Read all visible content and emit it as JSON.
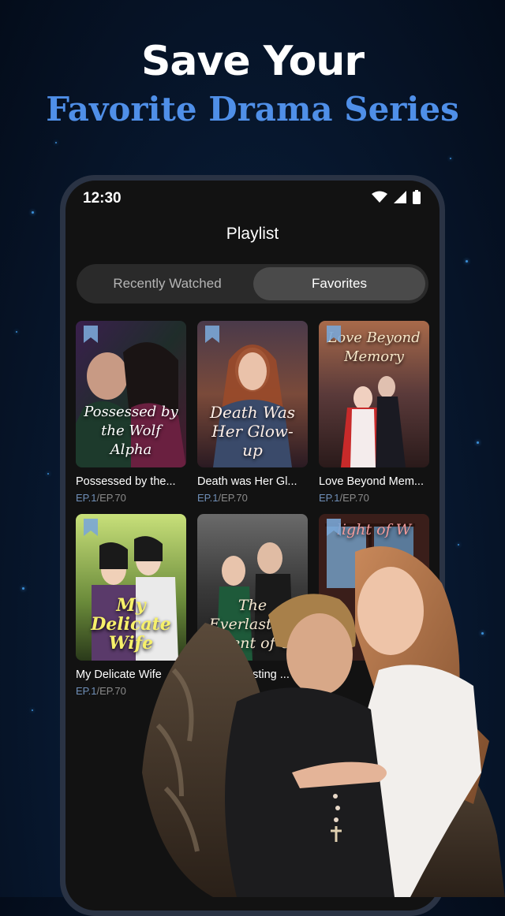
{
  "headline": {
    "line1": "Save Your",
    "line2": "Favorite Drama Series"
  },
  "status_bar": {
    "time": "12:30",
    "icons": [
      "wifi-icon",
      "signal-icon",
      "battery-icon"
    ]
  },
  "page": {
    "title": "Playlist"
  },
  "tabs": [
    {
      "label": "Recently Watched",
      "selected": false
    },
    {
      "label": "Favorites",
      "selected": true
    }
  ],
  "dramas": [
    {
      "title": "Possessed by the...",
      "poster_text": "Possessed by the Wolf Alpha",
      "ep_current": "EP.1",
      "ep_total": "/EP.70"
    },
    {
      "title": "Death was Her Gl...",
      "poster_text": "Death Was Her Glow-up",
      "ep_current": "EP.1",
      "ep_total": "/EP.70"
    },
    {
      "title": "Love Beyond Mem...",
      "poster_text": "Love Beyond Memory",
      "ep_current": "EP.1",
      "ep_total": "/EP.70"
    },
    {
      "title": "My Delicate Wife",
      "poster_text": "My Delicate Wife",
      "ep_current": "EP.1",
      "ep_total": "/EP.70"
    },
    {
      "title": "The Everlasting ...",
      "poster_text": "The Everlasting Scent of U",
      "ep_current": "",
      "ep_total": ""
    },
    {
      "title": "",
      "poster_text": "light of W",
      "ep_current": "",
      "ep_total": ""
    }
  ],
  "colors": {
    "accent_blue": "#4f8fe8",
    "tab_selected_bg": "#4a4a4a",
    "screen_bg": "#121212"
  }
}
